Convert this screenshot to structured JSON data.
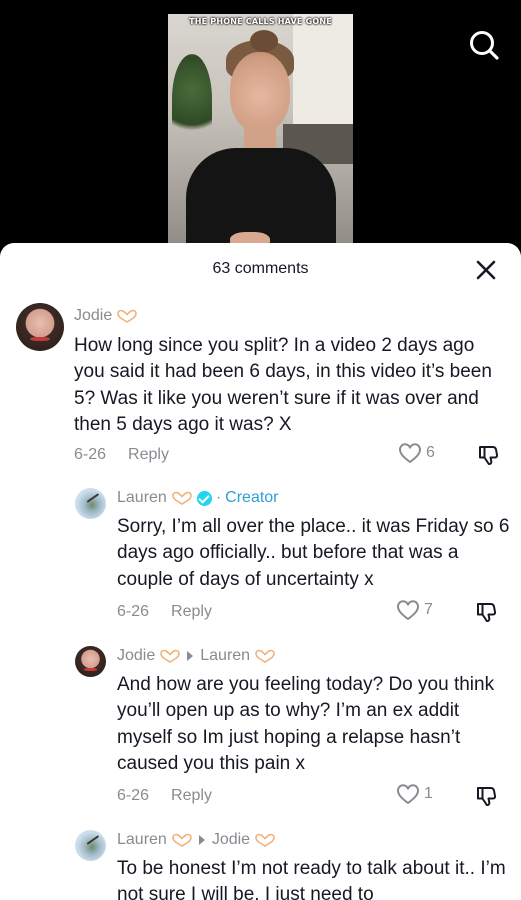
{
  "video": {
    "caption": "THE PHONE CALLS HAVE GONE"
  },
  "icons": {
    "search": "search-icon",
    "close": "close-icon",
    "heart_hands": "heart-hands-emoji",
    "verified": "verified-badge-icon",
    "like": "heart-outline-icon",
    "dislike": "thumbs-down-icon",
    "reply_arrow": "reply-arrow-icon"
  },
  "colors": {
    "creator": "#2b9fd6",
    "muted": "#8a8b91",
    "text": "#161823",
    "verified": "#20d5ec"
  },
  "sheet": {
    "title": "63 comments"
  },
  "comments": [
    {
      "author": "Jodie",
      "text": "How long since you split? In a video 2 days ago you said it had been 6 days, in this video it’s been 5? Was it like you weren’t sure if it was over and then 5 days ago it was? X",
      "date": "6-26",
      "reply_label": "Reply",
      "likes": "6"
    },
    {
      "author": "Lauren",
      "separator": "·",
      "badge": "Creator",
      "text": "Sorry, I’m all over the place.. it was Friday so 6 days ago officially.. but before that was a couple of days of uncertainty x",
      "date": "6-26",
      "reply_label": "Reply",
      "likes": "7"
    },
    {
      "author": "Jodie",
      "reply_to": "Lauren",
      "text": "And how are you feeling today? Do you think you’ll open up as to why? I’m an ex addit myself so Im just hoping a relapse hasn’t caused you this pain x",
      "date": "6-26",
      "reply_label": "Reply",
      "likes": "1"
    },
    {
      "author": "Lauren",
      "reply_to": "Jodie",
      "text": "To be honest I’m not ready to talk about it.. I’m not sure I will be. I just need to"
    }
  ]
}
